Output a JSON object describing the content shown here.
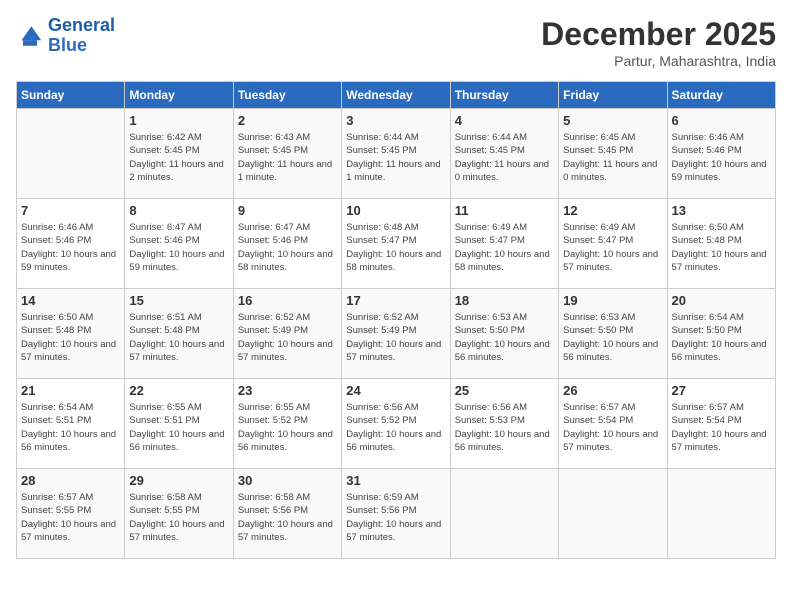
{
  "logo": {
    "text_general": "General",
    "text_blue": "Blue"
  },
  "title": "December 2025",
  "location": "Partur, Maharashtra, India",
  "days_of_week": [
    "Sunday",
    "Monday",
    "Tuesday",
    "Wednesday",
    "Thursday",
    "Friday",
    "Saturday"
  ],
  "weeks": [
    [
      {
        "day": "",
        "sunrise": "",
        "sunset": "",
        "daylight": ""
      },
      {
        "day": "1",
        "sunrise": "Sunrise: 6:42 AM",
        "sunset": "Sunset: 5:45 PM",
        "daylight": "Daylight: 11 hours and 2 minutes."
      },
      {
        "day": "2",
        "sunrise": "Sunrise: 6:43 AM",
        "sunset": "Sunset: 5:45 PM",
        "daylight": "Daylight: 11 hours and 1 minute."
      },
      {
        "day": "3",
        "sunrise": "Sunrise: 6:44 AM",
        "sunset": "Sunset: 5:45 PM",
        "daylight": "Daylight: 11 hours and 1 minute."
      },
      {
        "day": "4",
        "sunrise": "Sunrise: 6:44 AM",
        "sunset": "Sunset: 5:45 PM",
        "daylight": "Daylight: 11 hours and 0 minutes."
      },
      {
        "day": "5",
        "sunrise": "Sunrise: 6:45 AM",
        "sunset": "Sunset: 5:45 PM",
        "daylight": "Daylight: 11 hours and 0 minutes."
      },
      {
        "day": "6",
        "sunrise": "Sunrise: 6:46 AM",
        "sunset": "Sunset: 5:46 PM",
        "daylight": "Daylight: 10 hours and 59 minutes."
      }
    ],
    [
      {
        "day": "7",
        "sunrise": "Sunrise: 6:46 AM",
        "sunset": "Sunset: 5:46 PM",
        "daylight": "Daylight: 10 hours and 59 minutes."
      },
      {
        "day": "8",
        "sunrise": "Sunrise: 6:47 AM",
        "sunset": "Sunset: 5:46 PM",
        "daylight": "Daylight: 10 hours and 59 minutes."
      },
      {
        "day": "9",
        "sunrise": "Sunrise: 6:47 AM",
        "sunset": "Sunset: 5:46 PM",
        "daylight": "Daylight: 10 hours and 58 minutes."
      },
      {
        "day": "10",
        "sunrise": "Sunrise: 6:48 AM",
        "sunset": "Sunset: 5:47 PM",
        "daylight": "Daylight: 10 hours and 58 minutes."
      },
      {
        "day": "11",
        "sunrise": "Sunrise: 6:49 AM",
        "sunset": "Sunset: 5:47 PM",
        "daylight": "Daylight: 10 hours and 58 minutes."
      },
      {
        "day": "12",
        "sunrise": "Sunrise: 6:49 AM",
        "sunset": "Sunset: 5:47 PM",
        "daylight": "Daylight: 10 hours and 57 minutes."
      },
      {
        "day": "13",
        "sunrise": "Sunrise: 6:50 AM",
        "sunset": "Sunset: 5:48 PM",
        "daylight": "Daylight: 10 hours and 57 minutes."
      }
    ],
    [
      {
        "day": "14",
        "sunrise": "Sunrise: 6:50 AM",
        "sunset": "Sunset: 5:48 PM",
        "daylight": "Daylight: 10 hours and 57 minutes."
      },
      {
        "day": "15",
        "sunrise": "Sunrise: 6:51 AM",
        "sunset": "Sunset: 5:48 PM",
        "daylight": "Daylight: 10 hours and 57 minutes."
      },
      {
        "day": "16",
        "sunrise": "Sunrise: 6:52 AM",
        "sunset": "Sunset: 5:49 PM",
        "daylight": "Daylight: 10 hours and 57 minutes."
      },
      {
        "day": "17",
        "sunrise": "Sunrise: 6:52 AM",
        "sunset": "Sunset: 5:49 PM",
        "daylight": "Daylight: 10 hours and 57 minutes."
      },
      {
        "day": "18",
        "sunrise": "Sunrise: 6:53 AM",
        "sunset": "Sunset: 5:50 PM",
        "daylight": "Daylight: 10 hours and 56 minutes."
      },
      {
        "day": "19",
        "sunrise": "Sunrise: 6:53 AM",
        "sunset": "Sunset: 5:50 PM",
        "daylight": "Daylight: 10 hours and 56 minutes."
      },
      {
        "day": "20",
        "sunrise": "Sunrise: 6:54 AM",
        "sunset": "Sunset: 5:50 PM",
        "daylight": "Daylight: 10 hours and 56 minutes."
      }
    ],
    [
      {
        "day": "21",
        "sunrise": "Sunrise: 6:54 AM",
        "sunset": "Sunset: 5:51 PM",
        "daylight": "Daylight: 10 hours and 56 minutes."
      },
      {
        "day": "22",
        "sunrise": "Sunrise: 6:55 AM",
        "sunset": "Sunset: 5:51 PM",
        "daylight": "Daylight: 10 hours and 56 minutes."
      },
      {
        "day": "23",
        "sunrise": "Sunrise: 6:55 AM",
        "sunset": "Sunset: 5:52 PM",
        "daylight": "Daylight: 10 hours and 56 minutes."
      },
      {
        "day": "24",
        "sunrise": "Sunrise: 6:56 AM",
        "sunset": "Sunset: 5:52 PM",
        "daylight": "Daylight: 10 hours and 56 minutes."
      },
      {
        "day": "25",
        "sunrise": "Sunrise: 6:56 AM",
        "sunset": "Sunset: 5:53 PM",
        "daylight": "Daylight: 10 hours and 56 minutes."
      },
      {
        "day": "26",
        "sunrise": "Sunrise: 6:57 AM",
        "sunset": "Sunset: 5:54 PM",
        "daylight": "Daylight: 10 hours and 57 minutes."
      },
      {
        "day": "27",
        "sunrise": "Sunrise: 6:57 AM",
        "sunset": "Sunset: 5:54 PM",
        "daylight": "Daylight: 10 hours and 57 minutes."
      }
    ],
    [
      {
        "day": "28",
        "sunrise": "Sunrise: 6:57 AM",
        "sunset": "Sunset: 5:55 PM",
        "daylight": "Daylight: 10 hours and 57 minutes."
      },
      {
        "day": "29",
        "sunrise": "Sunrise: 6:58 AM",
        "sunset": "Sunset: 5:55 PM",
        "daylight": "Daylight: 10 hours and 57 minutes."
      },
      {
        "day": "30",
        "sunrise": "Sunrise: 6:58 AM",
        "sunset": "Sunset: 5:56 PM",
        "daylight": "Daylight: 10 hours and 57 minutes."
      },
      {
        "day": "31",
        "sunrise": "Sunrise: 6:59 AM",
        "sunset": "Sunset: 5:56 PM",
        "daylight": "Daylight: 10 hours and 57 minutes."
      },
      {
        "day": "",
        "sunrise": "",
        "sunset": "",
        "daylight": ""
      },
      {
        "day": "",
        "sunrise": "",
        "sunset": "",
        "daylight": ""
      },
      {
        "day": "",
        "sunrise": "",
        "sunset": "",
        "daylight": ""
      }
    ]
  ]
}
